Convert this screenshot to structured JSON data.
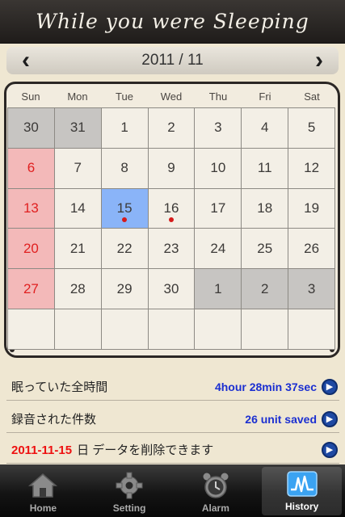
{
  "app": {
    "title": "While you were Sleeping"
  },
  "calendar": {
    "month_label": "2011 / 11",
    "weekdays": [
      "Sun",
      "Mon",
      "Tue",
      "Wed",
      "Thu",
      "Fri",
      "Sat"
    ],
    "weeks": [
      [
        "30",
        "31",
        "1",
        "2",
        "3",
        "4",
        "5"
      ],
      [
        "6",
        "7",
        "8",
        "9",
        "10",
        "11",
        "12"
      ],
      [
        "13",
        "14",
        "15",
        "16",
        "17",
        "18",
        "19"
      ],
      [
        "20",
        "21",
        "22",
        "23",
        "24",
        "25",
        "26"
      ],
      [
        "27",
        "28",
        "29",
        "30",
        "1",
        "2",
        "3"
      ],
      [
        "",
        "",
        "",
        "",
        "",
        "",
        ""
      ]
    ],
    "selected_day": "15",
    "recorded_days": [
      "15",
      "16"
    ]
  },
  "info": {
    "total_sleep_label": "眠っていた全時間",
    "total_sleep_value": "4hour 28min 37sec",
    "recordings_label": "録音された件数",
    "recordings_value": "26 unit saved",
    "delete_date": "2011-11-15",
    "delete_text": "日 データを削除できます"
  },
  "tabs": [
    {
      "label": "Home",
      "icon": "home-icon"
    },
    {
      "label": "Setting",
      "icon": "gear-icon"
    },
    {
      "label": "Alarm",
      "icon": "alarm-clock-icon"
    },
    {
      "label": "History",
      "icon": "waveform-icon"
    }
  ],
  "colors": {
    "sunday_bg": "#f3b9b9",
    "sunday_text": "#e02020",
    "selected_bg": "#8ab4f8",
    "other_month_bg": "#c7c5c2",
    "value_text": "#1b2fd1"
  }
}
